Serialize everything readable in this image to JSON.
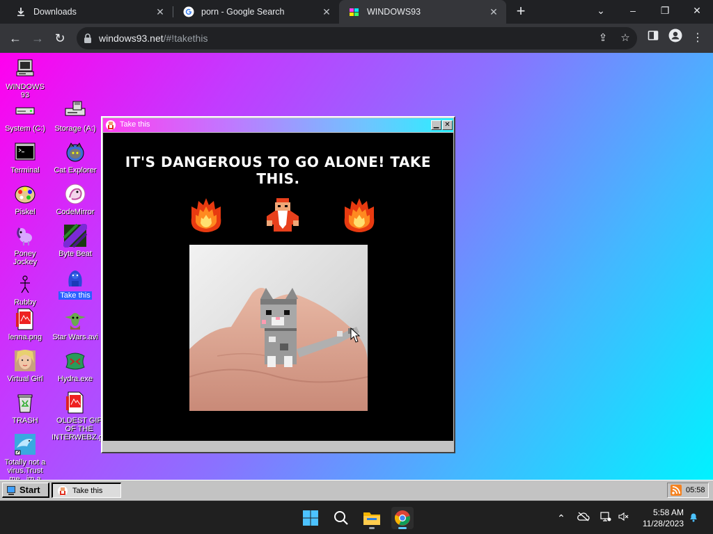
{
  "browser": {
    "tabs": [
      {
        "title": "Downloads",
        "icon": "download-icon"
      },
      {
        "title": "porn - Google Search",
        "icon": "google-icon"
      },
      {
        "title": "WINDOWS93",
        "icon": "windows93-icon",
        "active": true
      }
    ],
    "url_host": "windows93.net",
    "url_path": "/#!takethis"
  },
  "desktop": {
    "icons": [
      {
        "label": "WINDOWS 93",
        "icon": "computer-icon"
      },
      {
        "label": "System (C:)",
        "icon": "drive-icon"
      },
      {
        "label": "Storage (A:)",
        "icon": "floppy-drive-icon"
      },
      {
        "label": "Terminal",
        "icon": "terminal-icon"
      },
      {
        "label": "Cat Explorer",
        "icon": "cat-explorer-icon"
      },
      {
        "label": "Piskel",
        "icon": "palette-icon"
      },
      {
        "label": "CodeMirror",
        "icon": "codemirror-icon"
      },
      {
        "label": "Poney Jockey",
        "icon": "pony-icon"
      },
      {
        "label": "Byte Beat",
        "icon": "bytebeat-icon"
      },
      {
        "label": "Rubby",
        "icon": "stickman-icon"
      },
      {
        "label": "Take this",
        "icon": "take-this-icon",
        "selected": true
      },
      {
        "label": "lenna.png",
        "icon": "image-file-icon"
      },
      {
        "label": "Star Wars.avi",
        "icon": "yoda-icon"
      },
      {
        "label": "Virtual Girl",
        "icon": "virtual-girl-icon"
      },
      {
        "label": "Hydra.exe",
        "icon": "hydra-icon"
      },
      {
        "label": "TRASH",
        "icon": "trash-icon"
      },
      {
        "label": "OLDEST GIF OF THE INTERWEBZ.gif",
        "icon": "gif-file-icon"
      },
      {
        "label": "Totally not a virus.Trust me...im a",
        "icon": "dolphin-icon"
      }
    ]
  },
  "window": {
    "title": "Take this",
    "headline": "IT'S DANGEROUS TO GO ALONE! TAKE THIS."
  },
  "w93taskbar": {
    "start_label": "Start",
    "task_label": "Take this",
    "tray_time": "05:58"
  },
  "system": {
    "time": "5:58 AM",
    "date": "11/28/2023"
  },
  "colors": {
    "desktop_gradient_start": "#ff00ee",
    "desktop_gradient_end": "#00f2ff",
    "selection": "#2a60ff"
  }
}
